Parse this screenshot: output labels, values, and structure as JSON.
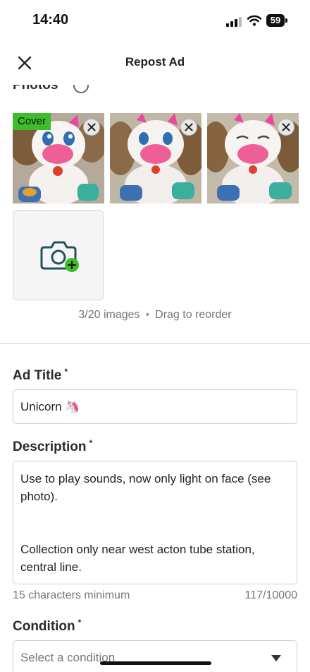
{
  "status_bar": {
    "time": "14:40",
    "battery": "59"
  },
  "nav": {
    "title": "Repost Ad",
    "close_icon": "close-icon"
  },
  "photos": {
    "heading": "Photos",
    "cover_label": "Cover",
    "items": [
      {
        "alt": "plush unicorn toy photo 1",
        "is_cover": true
      },
      {
        "alt": "plush unicorn toy photo 2",
        "is_cover": false
      },
      {
        "alt": "plush unicorn toy photo 3",
        "is_cover": false
      }
    ],
    "add_icon": "camera-plus-icon",
    "count_text": "3/20 images",
    "separator": "•",
    "hint_text": "Drag to reorder"
  },
  "form": {
    "title_label": "Ad Title",
    "required_mark": "*",
    "title_value": "Unicorn 🦄",
    "description_label": "Description",
    "description_value": "Use to play sounds, now only light on face (see photo).\n\n\nCollection only near west acton tube station, central line.",
    "description_min_text": "15 characters minimum",
    "description_count": "117/10000",
    "condition_label": "Condition",
    "condition_placeholder": "Select a condition"
  },
  "colors": {
    "accent_green": "#3ebd2a",
    "camera_teal": "#24525c"
  }
}
